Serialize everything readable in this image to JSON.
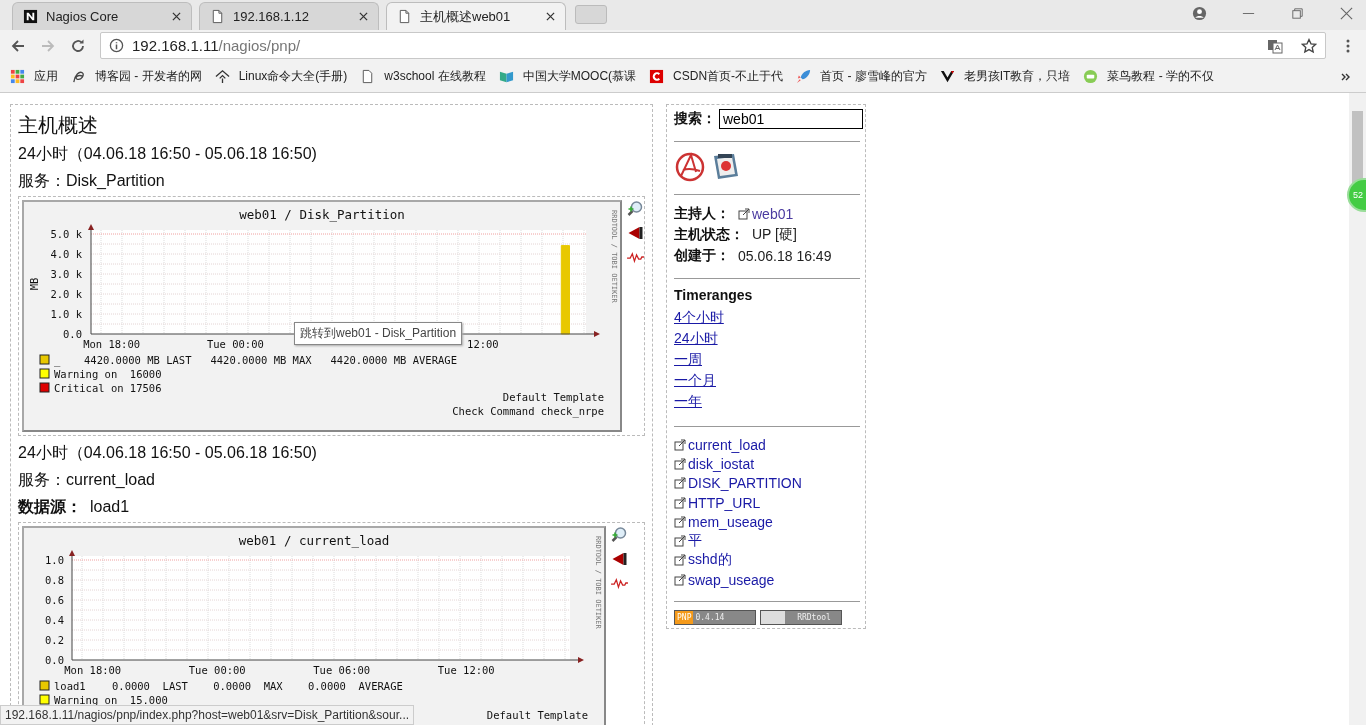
{
  "browser": {
    "tabs": [
      {
        "title": "Nagios Core",
        "selected": false
      },
      {
        "title": "192.168.1.12",
        "selected": false
      },
      {
        "title": "主机概述web01",
        "selected": true
      }
    ],
    "address": {
      "host": "192.168.1.11",
      "path": "/nagios/pnp/"
    },
    "bookmarks": [
      "应用",
      "博客园 - 开发者的网",
      "Linux命令大全(手册)",
      "w3school 在线教程",
      "中国大学MOOC(慕课",
      "CSDN首页-不止于代",
      "首页 - 廖雪峰的官方",
      "老男孩IT教育，只培",
      "菜鸟教程 - 学的不仅"
    ]
  },
  "main": {
    "title": "主机概述",
    "graphs": [
      {
        "range": "24小时（04.06.18 16:50 - 05.06.18 16:50)",
        "service": "服务：Disk_Partition",
        "chart_data": {
          "type": "bar",
          "title": "web01 / Disk_Partition",
          "ylabel": "MB",
          "grid": true,
          "ylim": [
            0,
            5000
          ],
          "categories": [
            null,
            "Mon 18:00",
            null,
            null,
            null,
            null,
            null,
            "Tue 00:00",
            null,
            null,
            null,
            null,
            null,
            null,
            null,
            null,
            null,
            null,
            null,
            "12:00",
            null,
            null,
            null,
            null,
            null
          ],
          "yticks": [
            {
              "value": 0,
              "label": "0.0"
            },
            {
              "value": 1000,
              "label": "1.0 k"
            },
            {
              "value": 2000,
              "label": "2.0 k"
            },
            {
              "value": 3000,
              "label": "3.0 k"
            },
            {
              "value": 4000,
              "label": "4.0 k"
            },
            {
              "value": 5000,
              "label": "5.0 k"
            }
          ],
          "series": [
            {
              "name": "_",
              "color": "#e8c800",
              "values": [
                null,
                null,
                null,
                null,
                null,
                null,
                null,
                null,
                null,
                null,
                null,
                null,
                null,
                null,
                null,
                null,
                null,
                null,
                null,
                null,
                null,
                null,
                null,
                4420,
                null
              ]
            }
          ]
        },
        "legend": [
          {
            "color": "#e8c800",
            "text": "4420.0000 MB LAST   4420.0000 MB MAX   4420.0000 MB AVERAGE"
          },
          {
            "color": "#ffff00",
            "text": "Warning on  16000"
          },
          {
            "color": "#dd0000",
            "text": "Critical on 17506"
          }
        ],
        "credit": "RRDTOOL / TOBI OETIKER",
        "footer": [
          "Default Template",
          "Check Command check_nrpe"
        ],
        "tooltip": "跳转到web01  -  Disk_Partition"
      },
      {
        "range": "24小时（04.06.18 16:50 - 05.06.18 16:50)",
        "service": "服务：current_load",
        "datasource_label": "数据源：",
        "datasource": "load1",
        "chart_data": {
          "type": "line",
          "title": "web01 / current_load",
          "grid": true,
          "ylim": [
            0,
            1
          ],
          "categories": [
            null,
            "Mon 18:00",
            null,
            null,
            null,
            null,
            null,
            "Tue 00:00",
            null,
            null,
            null,
            null,
            null,
            "Tue 06:00",
            null,
            null,
            null,
            null,
            null,
            "Tue 12:00",
            null,
            null,
            null,
            null,
            null
          ],
          "yticks": [
            {
              "value": 0,
              "label": "0.0"
            },
            {
              "value": 0.2,
              "label": "0.2"
            },
            {
              "value": 0.4,
              "label": "0.4"
            },
            {
              "value": 0.6,
              "label": "0.6"
            },
            {
              "value": 0.8,
              "label": "0.8"
            },
            {
              "value": 1,
              "label": "1.0"
            }
          ],
          "series": [
            {
              "name": "load1",
              "color": "#e8c800",
              "values": [
                null,
                null,
                null,
                null,
                null,
                null,
                null,
                null,
                null,
                null,
                null,
                null,
                null,
                null,
                null,
                null,
                null,
                null,
                null,
                null,
                null,
                null,
                null,
                null,
                null
              ]
            }
          ]
        },
        "legend": [
          {
            "color": "#e8c800",
            "text": "0.0000  LAST    0.0000  MAX    0.0000  AVERAGE"
          },
          {
            "color": "#ffff00",
            "text": "Warning on  15.000"
          }
        ],
        "credit": "RRDTOOL / TOBI OETIKER",
        "footer": [
          "Default Template"
        ]
      }
    ]
  },
  "sidebar": {
    "search": {
      "label": "搜索：",
      "value": "web01"
    },
    "info": [
      {
        "label": "主持人：",
        "value": "web01",
        "link": true
      },
      {
        "label": "主机状态：",
        "value": "UP [硬]",
        "link": false
      },
      {
        "label": "创建于：",
        "value": "05.06.18 16:49",
        "link": false
      }
    ],
    "timeranges_title": "Timeranges",
    "timeranges": [
      "4个小时",
      "24小时",
      "一周",
      "一个月",
      "一年"
    ],
    "services": [
      "current_load",
      "disk_iostat",
      "DISK_PARTITION",
      "HTTP_URL",
      "mem_useage",
      "平",
      "sshd的",
      "swap_useage"
    ],
    "badges": [
      {
        "kind": "pnp",
        "parts": [
          "PNP",
          "0.4.14"
        ]
      },
      {
        "kind": "rrd",
        "parts": [
          "RRDtool"
        ]
      }
    ]
  },
  "status_url": "192.168.1.11/nagios/pnp/index.php?host=web01&srv=Disk_Partition&sour...",
  "floating_badge": "52"
}
